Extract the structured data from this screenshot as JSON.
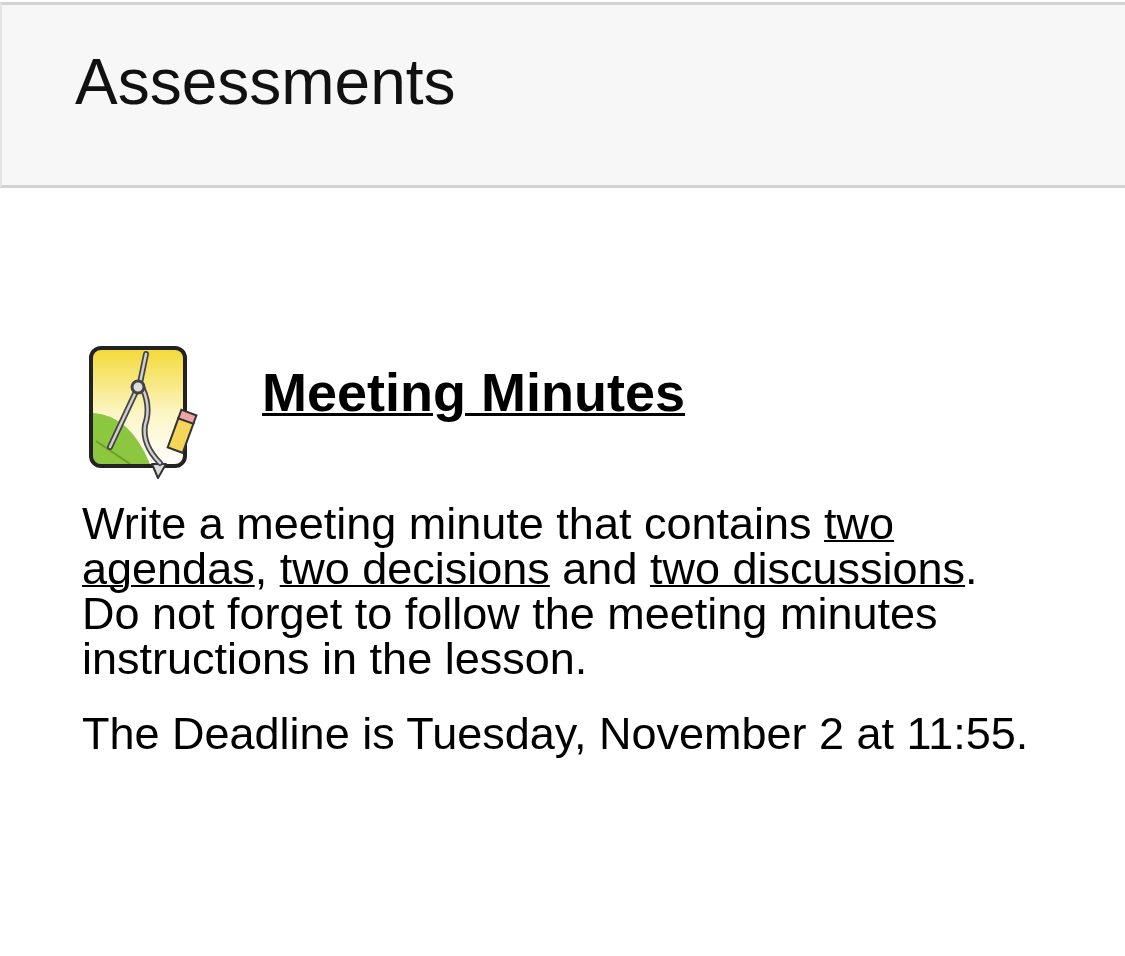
{
  "header": {
    "title": "Assessments"
  },
  "assessment": {
    "title": "Meeting Minutes",
    "description": [
      {
        "text": "Write a meeting minute that contains ",
        "underline": false
      },
      {
        "text": "two agendas",
        "underline": true
      },
      {
        "text": ", ",
        "underline": false
      },
      {
        "text": "two decisions",
        "underline": true
      },
      {
        "text": " and ",
        "underline": false
      },
      {
        "text": "two discussions",
        "underline": true
      },
      {
        "text": ". Do not forget to follow the meeting minutes instructions in the lesson.",
        "underline": false
      }
    ],
    "deadline": "The Deadline is Tuesday, November 2 at 11:55."
  }
}
